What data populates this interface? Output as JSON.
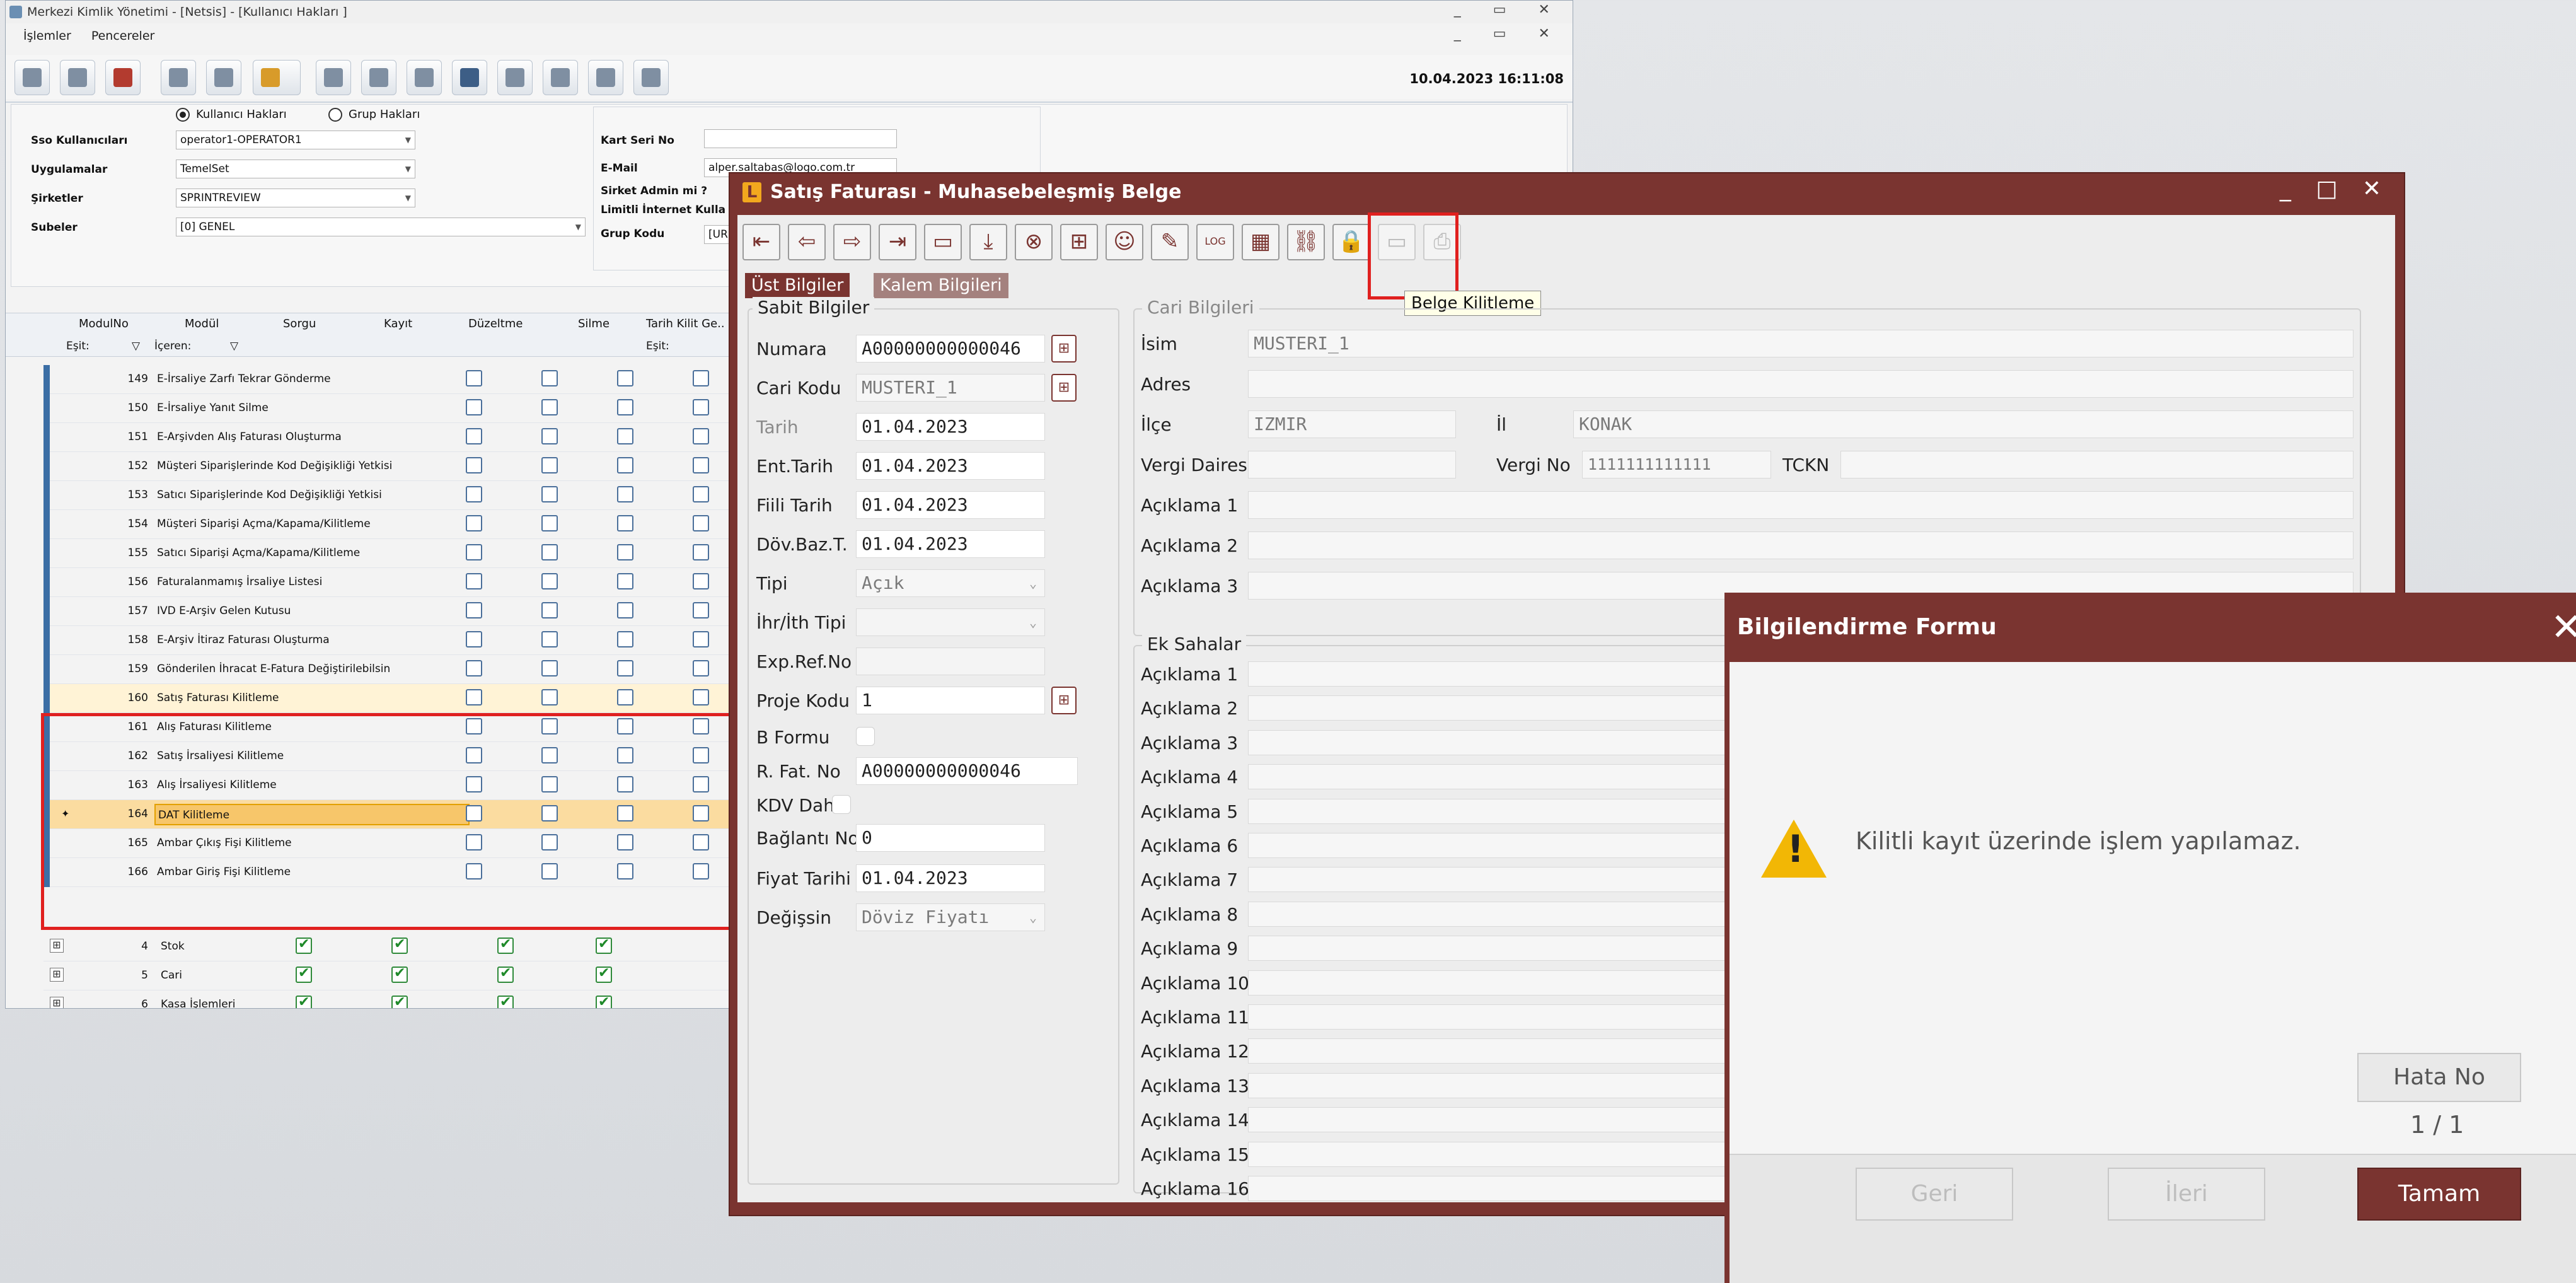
{
  "main": {
    "title": "Merkezi Kimlik Yönetimi - [Netsis] - [Kullanıcı Hakları ]",
    "menu": [
      "İşlemler",
      "Pencereler"
    ],
    "datetime": "10.04.2023 16:11:08",
    "radio_user_rights": "Kullanıcı Hakları",
    "radio_group_rights": "Grup Hakları",
    "labels": {
      "sso": "Sso Kullanıcıları",
      "apps": "Uygulamalar",
      "companies": "Şirketler",
      "branches": "Subeler",
      "card_serial": "Kart Seri No",
      "email": "E-Mail",
      "company_admin": "Sirket Admin mi ?",
      "limited_internet": "Limitli İnternet Kulla",
      "group_code": "Grup Kodu"
    },
    "values": {
      "sso": "operator1-OPERATOR1",
      "apps": "TemelSet",
      "companies": "SPRINTREVIEW",
      "branches": "[0] GENEL",
      "email": "alper.saltabas@logo.com.tr",
      "group_code": "[URE"
    },
    "grid": {
      "headers": [
        "ModulNo",
        "Modül",
        "Sorgu",
        "Kayıt",
        "Düzeltme",
        "Silme",
        "Tarih Kilit Ge.."
      ],
      "filter_eq": "Eşit:",
      "filter_contains": "İçeren:",
      "filter_eq2": "Eşit:",
      "rows": [
        {
          "no": "149",
          "name": "E-İrsaliye Zarfı Tekrar Gönderme"
        },
        {
          "no": "150",
          "name": "E-İrsaliye Yanıt Silme"
        },
        {
          "no": "151",
          "name": "E-Arşivden Alış Faturası Oluşturma"
        },
        {
          "no": "152",
          "name": "Müşteri Siparişlerinde Kod Değişikliği Yetkisi"
        },
        {
          "no": "153",
          "name": "Satıcı Siparişlerinde Kod Değişikliği Yetkisi"
        },
        {
          "no": "154",
          "name": "Müşteri Siparişi Açma/Kapama/Kilitleme"
        },
        {
          "no": "155",
          "name": "Satıcı Siparişi Açma/Kapama/Kilitleme"
        },
        {
          "no": "156",
          "name": "Faturalanmamış İrsaliye Listesi"
        },
        {
          "no": "157",
          "name": "IVD E-Arşiv Gelen Kutusu"
        },
        {
          "no": "158",
          "name": "E-Arşiv İtiraz Faturası Oluşturma"
        },
        {
          "no": "159",
          "name": "Gönderilen İhracat E-Fatura Değiştirilebilsin"
        },
        {
          "no": "160",
          "name": "Satış Faturası Kilitleme"
        },
        {
          "no": "161",
          "name": "Alış Faturası Kilitleme"
        },
        {
          "no": "162",
          "name": "Satış İrsaliyesi Kilitleme"
        },
        {
          "no": "163",
          "name": "Alış İrsaliyesi Kilitleme"
        },
        {
          "no": "164",
          "name": "DAT Kilitleme"
        },
        {
          "no": "165",
          "name": "Ambar Çıkış Fişi Kilitleme"
        },
        {
          "no": "166",
          "name": "Ambar Giriş Fişi Kilitleme"
        }
      ],
      "groups": [
        {
          "no": "4",
          "name": "Stok"
        },
        {
          "no": "5",
          "name": "Cari"
        },
        {
          "no": "6",
          "name": "Kasa İşlemleri"
        }
      ]
    }
  },
  "sf": {
    "title": "Satış Faturası -  Muhasebeleşmiş Belge",
    "tabs": [
      "Üst Bilgiler",
      "Kalem Bilgileri"
    ],
    "tooltip": "Belge Kilitleme",
    "sabit_legend": "Sabit Bilgiler",
    "cari_legend": "Cari Bilgileri",
    "ek_legend": "Ek Sahalar",
    "fields": {
      "numara_l": "Numara",
      "numara": "A00000000000046",
      "cari_kodu_l": "Cari Kodu",
      "cari_kodu": "MUSTERI_1",
      "tarih_l": "Tarih",
      "tarih": "01.04.2023",
      "ent_tarih_l": "Ent.Tarih",
      "ent_tarih": "01.04.2023",
      "fiili_tarih_l": "Fiili Tarih",
      "fiili_tarih": "01.04.2023",
      "dov_baz_l": "Döv.Baz.T.",
      "dov_baz": "01.04.2023",
      "tipi_l": "Tipi",
      "tipi": "Açık",
      "ihr_l": "İhr/İth Tipi",
      "expref_l": "Exp.Ref.No",
      "proje_l": "Proje Kodu",
      "proje": "1",
      "bformu_l": "B Formu",
      "rfat_l": "R. Fat. No",
      "rfat": "A00000000000046",
      "kdv_l": "KDV Dahil",
      "baglanti_l": "Bağlantı No",
      "baglanti": "0",
      "fiyat_tarihi_l": "Fiyat Tarihi",
      "fiyat_tarihi": "01.04.2023",
      "degissin_l": "Değişsin",
      "degissin": "Döviz Fiyatı"
    },
    "cari": {
      "isim_l": "İsim",
      "isim": "MUSTERI_1",
      "adres_l": "Adres",
      "ilce_l": "İlçe",
      "ilce": "IZMIR",
      "il_l": "İl",
      "il": "KONAK",
      "vergi_dairesi_l": "Vergi Dairesi",
      "vergi_no_l": "Vergi No",
      "vergi_no": "1111111111111",
      "tckn_l": "TCKN",
      "aciklama1_l": "Açıklama 1",
      "aciklama2_l": "Açıklama 2",
      "aciklama3_l": "Açıklama 3"
    },
    "ek": [
      "Açıklama 1",
      "Açıklama 2",
      "Açıklama 3",
      "Açıklama 4",
      "Açıklama 5",
      "Açıklama 6",
      "Açıklama 7",
      "Açıklama 8",
      "Açıklama 9",
      "Açıklama 10",
      "Açıklama 11",
      "Açıklama 12",
      "Açıklama 13",
      "Açıklama 14",
      "Açıklama 15",
      "Açıklama 16"
    ]
  },
  "dlg": {
    "title": "Bilgilendirme Formu",
    "message": "Kilitli kayıt üzerinde işlem yapılamaz.",
    "error_no_btn": "Hata No",
    "page": "1 / 1",
    "back": "Geri",
    "next": "İleri",
    "ok": "Tamam"
  },
  "colors": {
    "accent": "#7a3430",
    "selection": "#f7c66a",
    "highlight": "#e0201f"
  }
}
